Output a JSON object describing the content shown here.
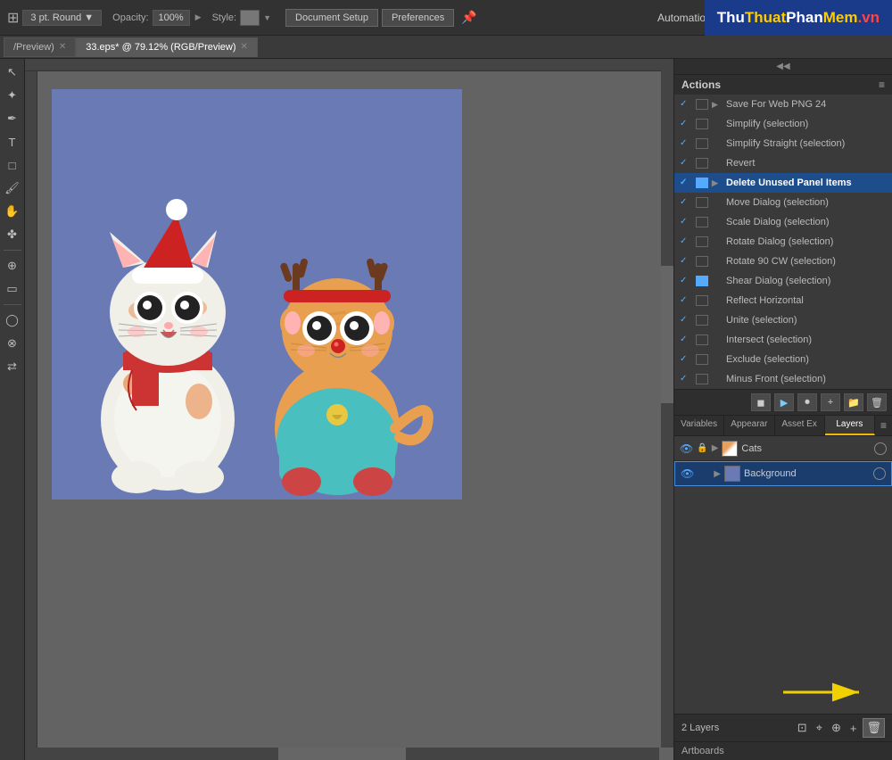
{
  "topbar": {
    "brush_size": "3 pt. Round",
    "opacity_label": "Opacity:",
    "opacity_val": "100%",
    "style_label": "Style:",
    "doc_setup_label": "Document Setup",
    "preferences_label": "Preferences",
    "automation_label": "Automation"
  },
  "brand": {
    "thu": "Thu",
    "thuat": "Thuat",
    "phan": "Phan",
    "mem": "Mem",
    "vn": ".vn"
  },
  "tabs": [
    {
      "label": "/Preview)",
      "close": true,
      "active": false
    },
    {
      "label": "33.eps* @ 79.12% (RGB/Preview)",
      "close": true,
      "active": true
    }
  ],
  "actions_panel": {
    "title": "Actions",
    "items": [
      {
        "checked": true,
        "square": false,
        "arrow": true,
        "name": "Save For Web PNG 24"
      },
      {
        "checked": true,
        "square": false,
        "arrow": false,
        "name": "Simplify (selection)"
      },
      {
        "checked": true,
        "square": false,
        "arrow": false,
        "name": "Simplify Straight (selection)"
      },
      {
        "checked": true,
        "square": false,
        "arrow": false,
        "name": "Revert"
      },
      {
        "checked": true,
        "square": true,
        "arrow": true,
        "name": "Delete Unused Panel Items",
        "selected": true
      },
      {
        "checked": true,
        "square": false,
        "arrow": false,
        "name": "Move Dialog (selection)"
      },
      {
        "checked": true,
        "square": false,
        "arrow": false,
        "name": "Scale Dialog (selection)"
      },
      {
        "checked": true,
        "square": false,
        "arrow": false,
        "name": "Rotate Dialog (selection)"
      },
      {
        "checked": true,
        "square": false,
        "arrow": false,
        "name": "Rotate 90 CW (selection)"
      },
      {
        "checked": true,
        "square": true,
        "arrow": false,
        "name": "Shear Dialog (selection)"
      },
      {
        "checked": true,
        "square": false,
        "arrow": false,
        "name": "Reflect Horizontal"
      },
      {
        "checked": true,
        "square": false,
        "arrow": false,
        "name": "Unite (selection)"
      },
      {
        "checked": true,
        "square": false,
        "arrow": false,
        "name": "Intersect (selection)"
      },
      {
        "checked": true,
        "square": false,
        "arrow": false,
        "name": "Exclude (selection)"
      },
      {
        "checked": true,
        "square": false,
        "arrow": false,
        "name": "Minus Front (selection)"
      }
    ]
  },
  "panel_tabs": {
    "tabs": [
      "Variables",
      "Appearar",
      "Asset Ex",
      "Layers"
    ]
  },
  "layers": {
    "items": [
      {
        "name": "Cats",
        "visible": true,
        "locked": false,
        "type": "cats"
      },
      {
        "name": "Background",
        "visible": true,
        "locked": false,
        "type": "bg",
        "selected": true
      }
    ],
    "count": "2 Layers"
  },
  "artboards": {
    "label": "Artboards"
  }
}
